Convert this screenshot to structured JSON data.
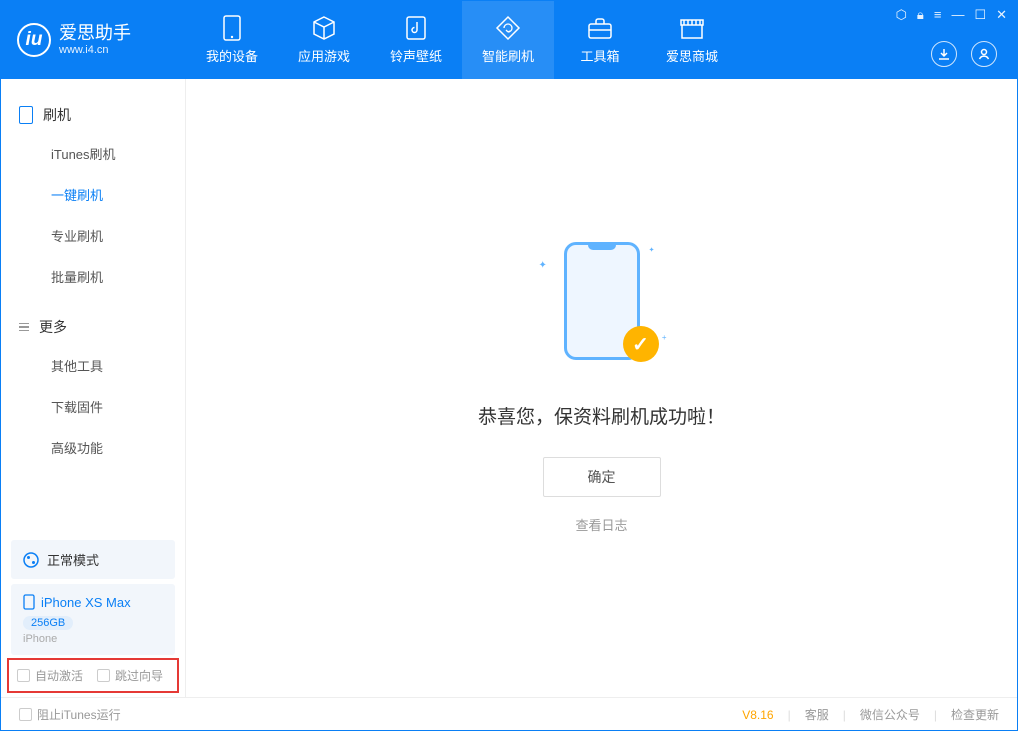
{
  "app": {
    "name": "爱思助手",
    "url": "www.i4.cn"
  },
  "nav": {
    "tabs": [
      {
        "label": "我的设备",
        "icon": "device"
      },
      {
        "label": "应用游戏",
        "icon": "cube"
      },
      {
        "label": "铃声壁纸",
        "icon": "music"
      },
      {
        "label": "智能刷机",
        "icon": "refresh",
        "active": true
      },
      {
        "label": "工具箱",
        "icon": "toolbox"
      },
      {
        "label": "爱思商城",
        "icon": "shop"
      }
    ]
  },
  "sidebar": {
    "section1": {
      "title": "刷机"
    },
    "items1": [
      {
        "label": "iTunes刷机"
      },
      {
        "label": "一键刷机",
        "active": true
      },
      {
        "label": "专业刷机"
      },
      {
        "label": "批量刷机"
      }
    ],
    "section2": {
      "title": "更多"
    },
    "items2": [
      {
        "label": "其他工具"
      },
      {
        "label": "下载固件"
      },
      {
        "label": "高级功能"
      }
    ],
    "status": {
      "label": "正常模式"
    },
    "device": {
      "name": "iPhone XS Max",
      "storage": "256GB",
      "type": "iPhone"
    },
    "checkboxes": {
      "auto_activate": "自动激活",
      "skip_guide": "跳过向导"
    }
  },
  "main": {
    "success_message": "恭喜您，保资料刷机成功啦！",
    "confirm_button": "确定",
    "view_log": "查看日志"
  },
  "footer": {
    "block_itunes": "阻止iTunes运行",
    "version": "V8.16",
    "links": [
      "客服",
      "微信公众号",
      "检查更新"
    ]
  }
}
